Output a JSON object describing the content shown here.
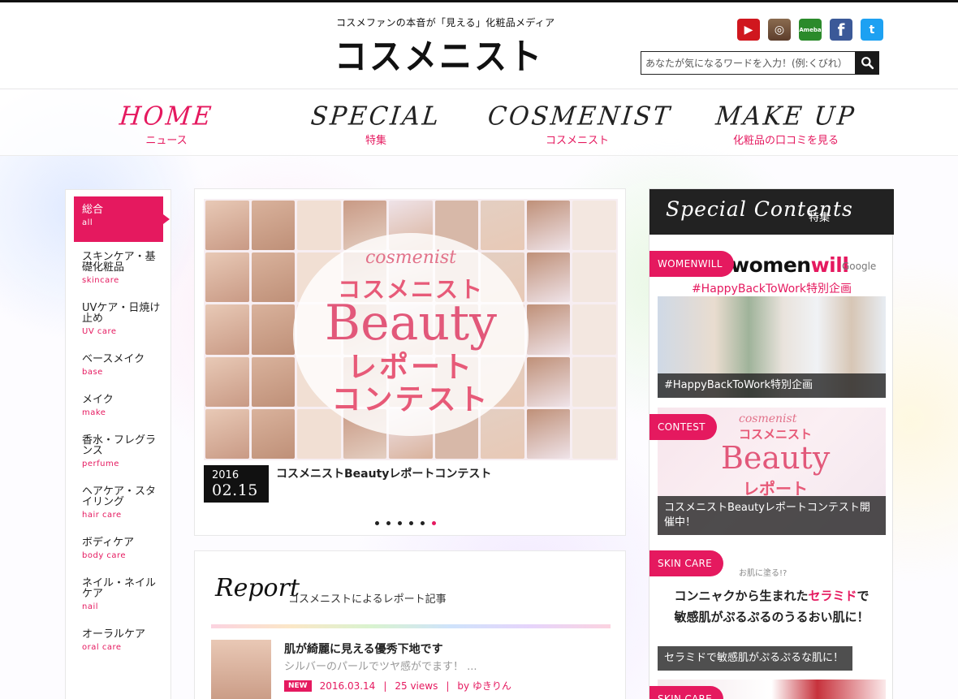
{
  "header": {
    "tagline": "コスメファンの本音が「見える」化粧品メディア",
    "logo": "コスメニスト",
    "socials": [
      {
        "name": "youtube-icon",
        "glyph": "▶"
      },
      {
        "name": "instagram-icon",
        "glyph": "◎"
      },
      {
        "name": "ameba-icon",
        "glyph": "Ameba"
      },
      {
        "name": "facebook-icon",
        "glyph": "f"
      },
      {
        "name": "twitter-icon",
        "glyph": "t"
      }
    ],
    "search": {
      "placeholder": "あなたが気になるワードを入力！(例:くびれ）"
    }
  },
  "nav": [
    {
      "en": "HOME",
      "jp": "ニュース"
    },
    {
      "en": "SPECIAL",
      "jp": "特集"
    },
    {
      "en": "COSMENIST",
      "jp": "コスメニスト"
    },
    {
      "en": "MAKE UP",
      "jp": "化粧品の口コミを見る"
    }
  ],
  "sidebar": {
    "items": [
      {
        "jp": "総合",
        "en": "all"
      },
      {
        "jp": "スキンケア・基礎化粧品",
        "en": "skincare"
      },
      {
        "jp": "UVケア・日焼け止め",
        "en": "UV care"
      },
      {
        "jp": "ベースメイク",
        "en": "base"
      },
      {
        "jp": "メイク",
        "en": "make"
      },
      {
        "jp": "香水・フレグランス",
        "en": "perfume"
      },
      {
        "jp": "ヘアケア・スタイリング",
        "en": "hair care"
      },
      {
        "jp": "ボディケア",
        "en": "body care"
      },
      {
        "jp": "ネイル・ネイルケア",
        "en": "nail"
      },
      {
        "jp": "オーラルケア",
        "en": "oral care"
      }
    ]
  },
  "slider": {
    "hero": {
      "line1": "cosmenist",
      "line2": "コスメニスト",
      "line3": "Beauty",
      "line4": "レポート",
      "line5": "コンテスト"
    },
    "date_year": "2016",
    "date_md": "02.15",
    "title": "コスメニストBeautyレポートコンテスト",
    "dots": 6,
    "active_dot": 5
  },
  "report": {
    "heading": "Report",
    "subheading": "コスメニストによるレポート記事",
    "article": {
      "title": "肌が綺麗に見える優秀下地です",
      "excerpt": "シルバーのパールでツヤ感がでます！ ...",
      "badge": "NEW",
      "date": "2016.03.14",
      "views": "25 views",
      "author": "by ゆきりん"
    }
  },
  "special": {
    "heading_en": "Special Contents",
    "heading_jp": "特集",
    "womenwill": {
      "tag": "WOMENWILL",
      "logo_a": "women",
      "logo_b": "will",
      "google": "Google",
      "hashtag": "#HappyBackToWork特別企画",
      "caption": "#HappyBackToWork特別企画"
    },
    "contest": {
      "tag": "CONTEST",
      "img_line1": "cosmenist",
      "img_line2": "コスメニスト",
      "img_line3": "Beauty",
      "img_line4": "レポート",
      "caption": "コスメニストBeautyレポートコンテスト開催中！"
    },
    "skincare": {
      "tag": "SKIN CARE",
      "small": "お肌に塗る!?",
      "title_a": "コンニャクから生まれた",
      "title_b": "セラミド",
      "title_c": "で",
      "title_d": "敏感肌がぷるぷるのうるおい肌に！",
      "caption": "セラミドで敏感肌がぷるぷるな肌に！"
    },
    "skincare2": {
      "tag": "SKIN CARE"
    }
  },
  "colors": {
    "accent": "#e5195f",
    "dark": "#222222"
  }
}
